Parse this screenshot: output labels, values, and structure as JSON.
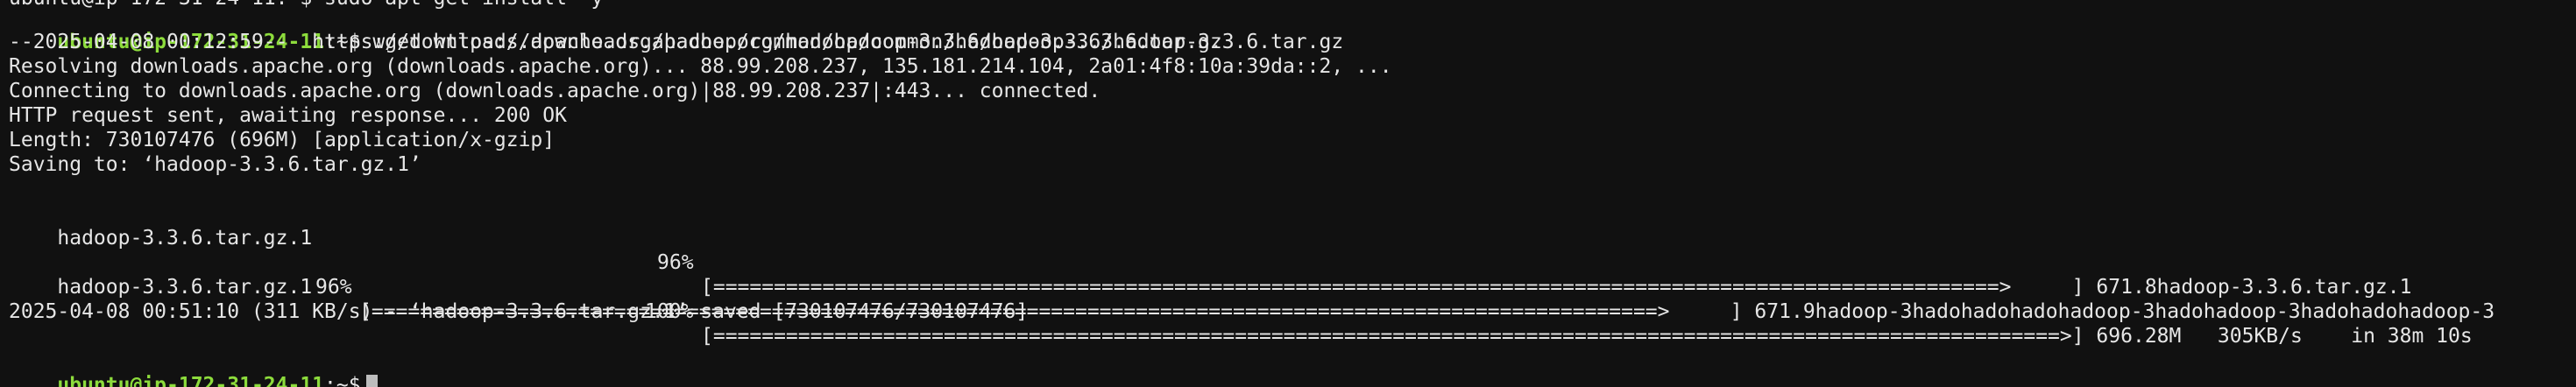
{
  "terminal": {
    "top_fragment": "ubuntu@ip-172-31-24-11:~$ sudo apt-get install -y",
    "prompt1": {
      "user_host": "ubuntu@ip-172-31-24-11",
      "symbol": ":~$",
      "command": " wget https://downloads.apache.org/hadoop/common/hadoop-3.3.6/hadoop-3.3.6.tar.gz"
    },
    "lines": [
      "--2025-04-08 00:12:59--  https://downloads.apache.org/hadoop/common/hadoop-3.3.6/hadoop-3.3.6.tar.gz",
      "Resolving downloads.apache.org (downloads.apache.org)... 88.99.208.237, 135.181.214.104, 2a01:4f8:10a:39da::2, ...",
      "Connecting to downloads.apache.org (downloads.apache.org)|88.99.208.237|:443... connected.",
      "HTTP request sent, awaiting response... 200 OK",
      "Length: 730107476 (696M) [application/x-gzip]",
      "Saving to: ‘hadoop-3.3.6.tar.gz.1’"
    ],
    "progress": [
      {
        "name": "hadoop-3.3.6.tar.gz.1",
        "percent_text": "96%",
        "bar": "[==========================================================================================================>     ]",
        "tail": " 671.8hadoop-3.3.6.tar.gz.1"
      },
      {
        "name": "",
        "percent_text": "96%",
        "bar": "[==========================================================================================================>     ]",
        "tail": " 671.9hadoop-3hadohadohadohadoop-3hadohadoop-3hadohadohadoop-3"
      },
      {
        "name": "hadoop-3.3.6.tar.gz.1",
        "percent_text": "100%",
        "bar": "[===============================================================================================================>]",
        "tail": " 696.28M   305KB/s    in 38m 10s"
      }
    ],
    "saved_line": "2025-04-08 00:51:10 (311 KB/s) - ‘hadoop-3.3.6.tar.gz.1’ saved [730107476/730107476]",
    "prompt2": {
      "user_host": "ubuntu@ip-172-31-24-11",
      "symbol": ":~$"
    },
    "colors": {
      "background": "#111111",
      "text": "#e6e6e6",
      "prompt_user": "#8ddc3c",
      "cursor": "#bdbdbd"
    }
  }
}
